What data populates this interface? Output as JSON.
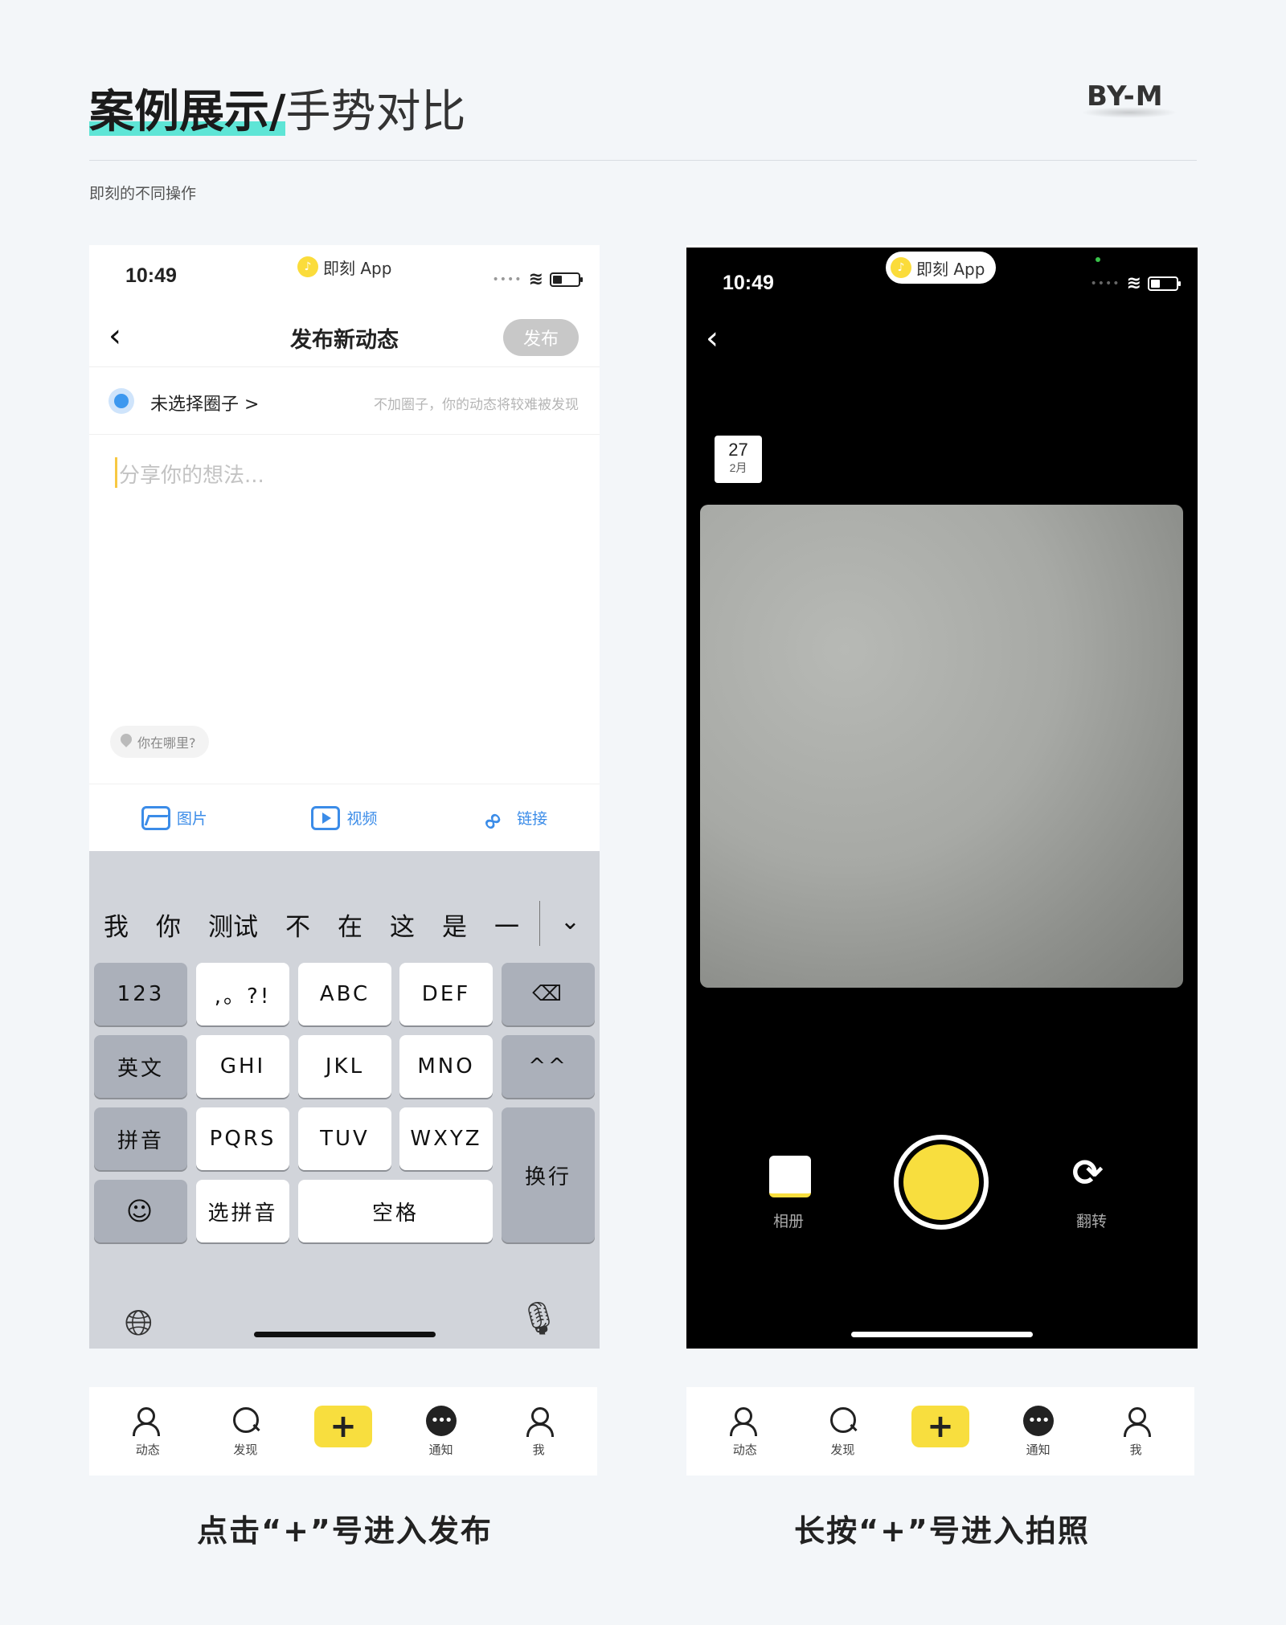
{
  "header": {
    "title_strong": "案例展示/",
    "title_thin": "手势对比",
    "brand": "BY-M",
    "subtitle": "即刻的不同操作"
  },
  "status": {
    "time": "10:49",
    "app_name": "即刻 App"
  },
  "publish_screen": {
    "nav_title": "发布新动态",
    "publish_button": "发布",
    "circle_label": "未选择圈子 >",
    "circle_hint": "不加圈子，你的动态将较难被发现",
    "placeholder": "分享你的想法...",
    "location": "你在哪里?",
    "attachments": [
      "图片",
      "视频",
      "链接"
    ],
    "candidates": [
      "我",
      "你",
      "测试",
      "不",
      "在",
      "这",
      "是",
      "一"
    ],
    "keys": {
      "k123": "123",
      "punct": ",。?!",
      "abc": "ABC",
      "def": "DEF",
      "english": "英文",
      "ghi": "GHI",
      "jkl": "JKL",
      "mno": "MNO",
      "caret": "^^",
      "pinyin": "拼音",
      "pqrs": "PQRS",
      "tuv": "TUV",
      "wxyz": "WXYZ",
      "enter": "换行",
      "select_pinyin": "选拼音",
      "space": "空格"
    }
  },
  "camera_screen": {
    "date_day": "27",
    "date_month": "2月",
    "album_label": "相册",
    "flip_label": "翻转"
  },
  "tabbar": {
    "tabs": [
      "动态",
      "发现",
      "+",
      "通知",
      "我"
    ]
  },
  "captions": {
    "left": "点击“+”号进入发布",
    "right": "长按“+”号进入拍照"
  },
  "colors": {
    "accent_yellow": "#f8de3e",
    "accent_blue": "#3b8ce8",
    "highlight_teal": "#5ee5d6"
  }
}
